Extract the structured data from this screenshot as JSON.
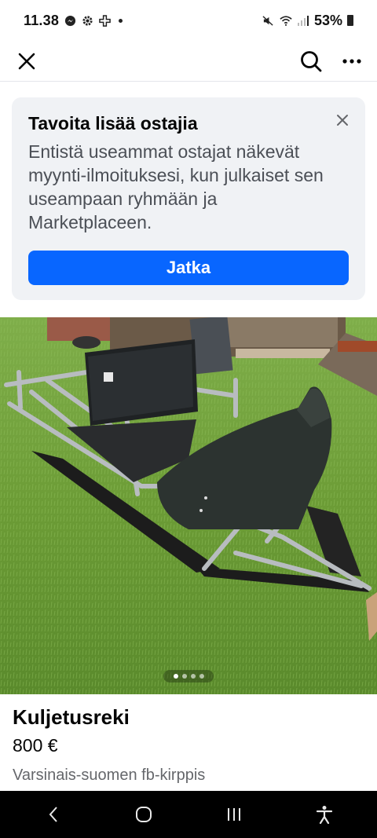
{
  "status_bar": {
    "time": "11.38",
    "battery_percent": "53%"
  },
  "top_bar": {
    "close_icon": "close-icon",
    "search_icon": "search-icon",
    "more_icon": "more-options-icon"
  },
  "promo": {
    "title": "Tavoita lisää ostajia",
    "body": "Entistä useammat ostajat näkevät myynti-ilmoituksesi, kun julkaiset sen useampaan ryhmään ja Marketplaceen.",
    "button_label": "Jatka"
  },
  "listing": {
    "photo_count": 4,
    "active_photo": 1,
    "title": "Kuljetusreki",
    "price": "800 €",
    "group": "Varsinais-suomen fb-kirppis"
  },
  "colors": {
    "accent": "#0866ff",
    "card_bg": "#f0f2f5",
    "secondary_text": "#65676b"
  }
}
